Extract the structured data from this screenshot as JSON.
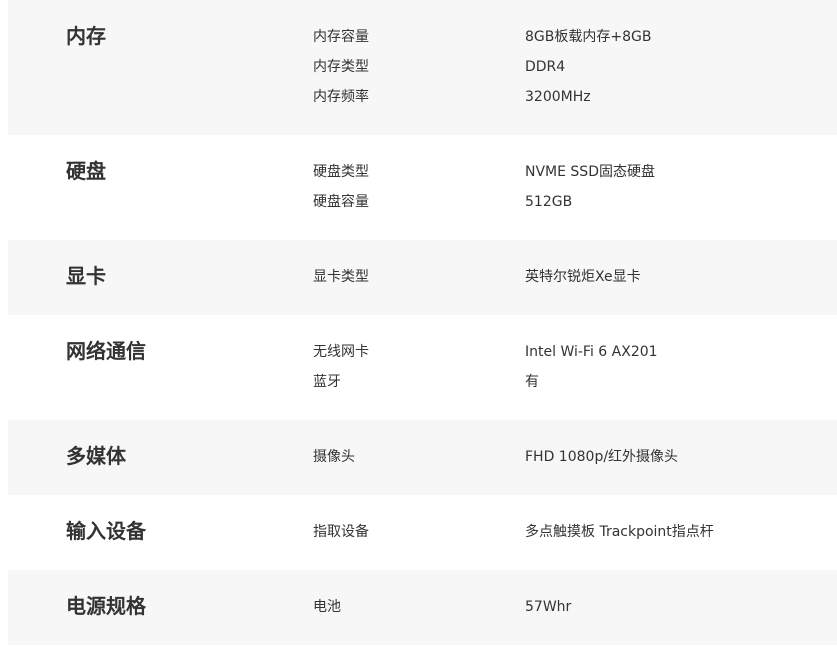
{
  "sections": [
    {
      "title": "内存",
      "rows": [
        {
          "label": "内存容量",
          "value": "8GB板载内存+8GB"
        },
        {
          "label": "内存类型",
          "value": "DDR4"
        },
        {
          "label": "内存频率",
          "value": "3200MHz"
        }
      ]
    },
    {
      "title": "硬盘",
      "rows": [
        {
          "label": "硬盘类型",
          "value": "NVME SSD固态硬盘"
        },
        {
          "label": "硬盘容量",
          "value": "512GB"
        }
      ]
    },
    {
      "title": "显卡",
      "rows": [
        {
          "label": "显卡类型",
          "value": "英特尔锐炬Xe显卡"
        }
      ]
    },
    {
      "title": "网络通信",
      "rows": [
        {
          "label": "无线网卡",
          "value": "Intel Wi-Fi 6 AX201"
        },
        {
          "label": "蓝牙",
          "value": "有"
        }
      ]
    },
    {
      "title": "多媒体",
      "rows": [
        {
          "label": "摄像头",
          "value": "FHD 1080p/红外摄像头"
        }
      ]
    },
    {
      "title": "输入设备",
      "rows": [
        {
          "label": "指取设备",
          "value": "多点触摸板 Trackpoint指点杆"
        }
      ]
    },
    {
      "title": "电源规格",
      "rows": [
        {
          "label": "电池",
          "value": "57Whr"
        }
      ]
    }
  ]
}
